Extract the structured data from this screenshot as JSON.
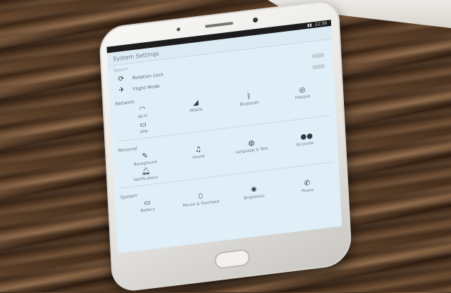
{
  "screen": {
    "title": "System Settings",
    "search_placeholder": "Search",
    "status_time": "12:39"
  },
  "quick_rows": [
    {
      "label": "Rotation Lock",
      "icon": "rotation-icon"
    },
    {
      "label": "Flight Mode",
      "icon": "airplane-icon"
    }
  ],
  "sections": {
    "network": {
      "title": "Network",
      "items": [
        {
          "label": "Wi-Fi",
          "icon": "wifi-icon"
        },
        {
          "label": "Mobile",
          "icon": "signal-icon"
        },
        {
          "label": "Bluetooth",
          "icon": "bluetooth-icon"
        },
        {
          "label": "Hotspot",
          "icon": "hotspot-icon"
        },
        {
          "label": "VPN",
          "icon": "vpn-icon"
        }
      ]
    },
    "personal": {
      "title": "Personal",
      "items": [
        {
          "label": "Background",
          "icon": "brush-icon"
        },
        {
          "label": "Sound",
          "icon": "music-note-icon"
        },
        {
          "label": "Language & Text",
          "icon": "globe-icon"
        },
        {
          "label": "Accounts",
          "icon": "accounts-icon"
        },
        {
          "label": "Notifications",
          "icon": "bell-icon"
        }
      ]
    },
    "system": {
      "title": "System",
      "items": [
        {
          "label": "Battery",
          "icon": "battery-icon"
        },
        {
          "label": "Mouse & Touchpad",
          "icon": "mouse-icon"
        },
        {
          "label": "Brightness",
          "icon": "brightness-icon"
        },
        {
          "label": "Phone",
          "icon": "phone-icon"
        }
      ]
    }
  }
}
